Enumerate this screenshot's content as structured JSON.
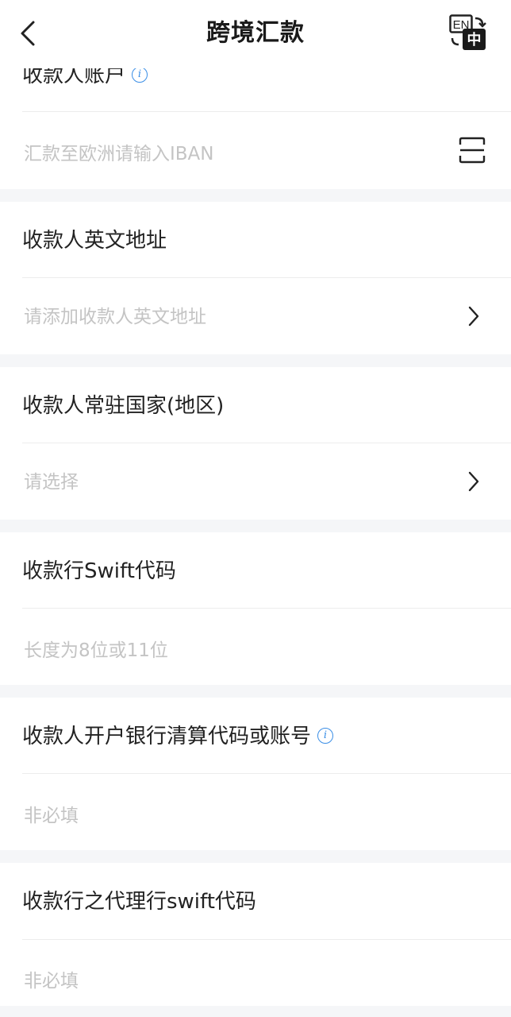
{
  "header": {
    "title": "跨境汇款",
    "lang_toggle": {
      "top": "EN",
      "bottom": "中"
    }
  },
  "sections": [
    {
      "label": "收款人账户",
      "has_info": true,
      "placeholder": "汇款至欧洲请输入IBAN",
      "action": "scan-icon"
    },
    {
      "label": "收款人英文地址",
      "has_info": false,
      "placeholder": "请添加收款人英文地址",
      "action": "chevron-right-icon"
    },
    {
      "label": "收款人常驻国家(地区)",
      "has_info": false,
      "placeholder": "请选择",
      "action": "chevron-right-icon"
    },
    {
      "label": "收款行Swift代码",
      "has_info": false,
      "placeholder": "长度为8位或11位",
      "action": ""
    },
    {
      "label": "收款人开户银行清算代码或账号",
      "has_info": true,
      "placeholder": "非必填",
      "action": ""
    },
    {
      "label": "收款行之代理行swift代码",
      "has_info": false,
      "placeholder": "非必填",
      "action": ""
    }
  ],
  "colors": {
    "info_blue": "#3a8ee6",
    "placeholder": "#c4c4c4",
    "background_gap": "#f5f6f8"
  }
}
